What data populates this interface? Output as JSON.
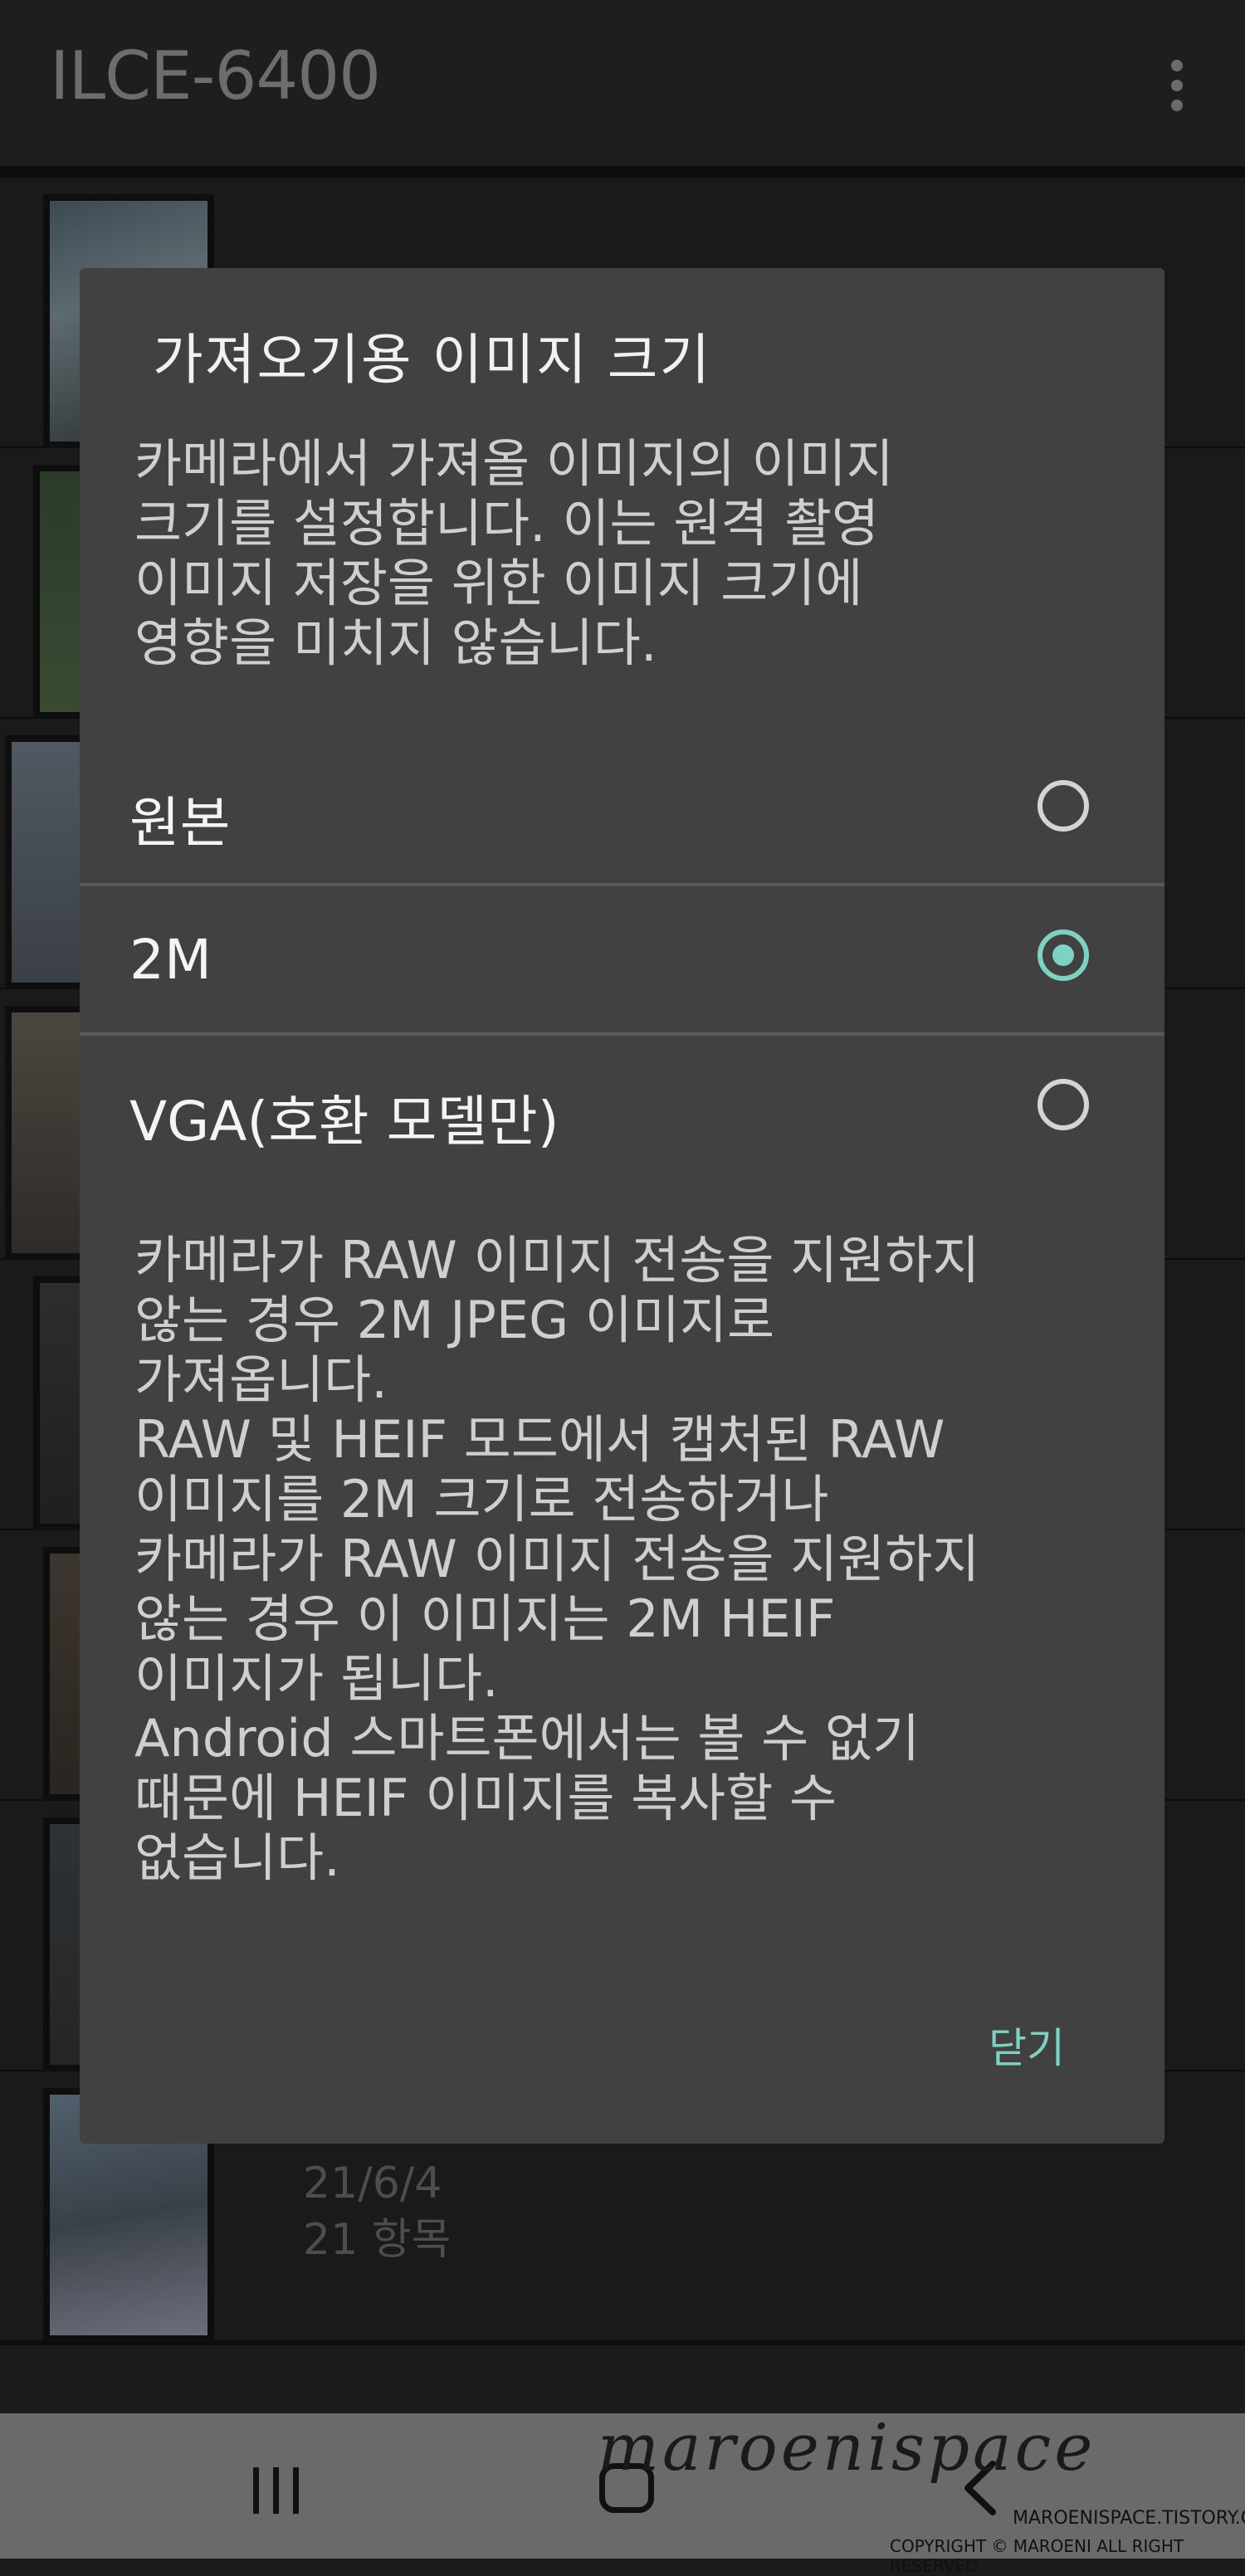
{
  "appbar": {
    "title": "ILCE-6400",
    "more_icon": "more-vert-icon"
  },
  "list": {
    "rows": [
      {
        "date": "",
        "count": ""
      },
      {
        "date": "",
        "count": ""
      },
      {
        "date": "",
        "count": ""
      },
      {
        "date": "",
        "count": ""
      },
      {
        "date": "",
        "count": ""
      },
      {
        "date": "",
        "count": ""
      },
      {
        "date": "",
        "count": ""
      },
      {
        "date": "21/6/4",
        "count": "21 항목"
      }
    ]
  },
  "dialog": {
    "title": "가져오기용 이미지 크기",
    "description": "카메라에서 가져올 이미지의 이미지\n크기를 설정합니다. 이는 원격 촬영\n이미지 저장을 위한 이미지 크기에\n영향을 미치지 않습니다.",
    "options": [
      {
        "label": "원본",
        "selected": false
      },
      {
        "label": "2M",
        "selected": true
      },
      {
        "label": "VGA(호환 모델만)",
        "selected": false
      }
    ],
    "note": "카메라가 RAW 이미지 전송을 지원하지\n않는 경우 2M JPEG 이미지로\n가져옵니다.\nRAW 및 HEIF 모드에서 캡처된 RAW\n이미지를 2M 크기로 전송하거나\n카메라가 RAW 이미지 전송을 지원하지\n않는 경우 이 이미지는 2M HEIF\n이미지가 됩니다.\nAndroid 스마트폰에서는 볼 수 없기\n때문에 HEIF 이미지를 복사할 수\n없습니다.",
    "close_label": "닫기",
    "accent_color": "#7fd2c3"
  },
  "navbar": {
    "recent_icon": "recent-apps-icon",
    "home_icon": "home-icon",
    "back_icon": "back-icon"
  },
  "watermark": {
    "signature": "maroenispace",
    "url": "MAROENISPACE.TISTORY.COM",
    "copyright": "COPYRIGHT © MAROENI ALL RIGHT RESERVED"
  }
}
